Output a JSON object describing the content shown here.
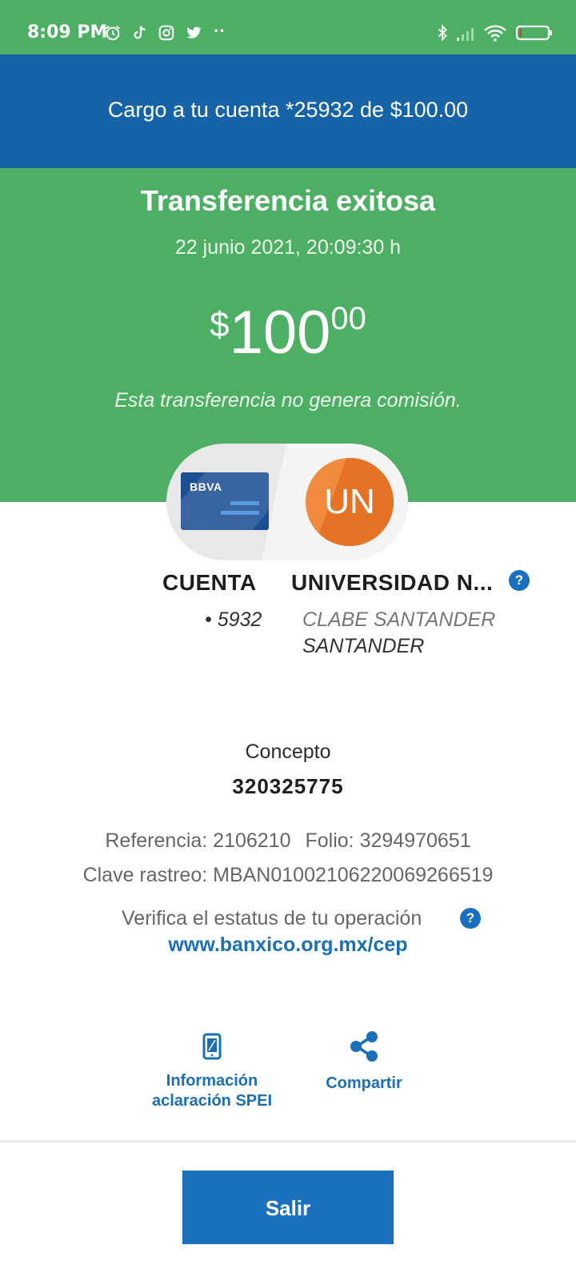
{
  "status_bar": {
    "time": "8:09 PM",
    "more": "··"
  },
  "banner": {
    "text": "Cargo a tu cuenta *25932 de $100.00"
  },
  "success": {
    "title": "Transferencia exitosa",
    "datetime": "22 junio 2021, 20:09:30 h",
    "amount_currency": "$",
    "amount_integer": "100",
    "amount_decimals": "00",
    "no_fee_text": "Esta transferencia no genera comisión."
  },
  "origin": {
    "bank_logo_text": "BBVA",
    "label": "CUENTA",
    "number": "• 5932"
  },
  "destination": {
    "avatar_initials": "UN",
    "name": "UNIVERSIDAD N...",
    "line1": "CLABE SANTANDER",
    "line2": "SANTANDER"
  },
  "concept": {
    "label": "Concepto",
    "value": "320325775"
  },
  "reference": {
    "text": "Referencia: 2106210",
    "folio": "Folio: 3294970651",
    "trace": "Clave rastreo: MBAN01002106220069266519"
  },
  "verify": {
    "text": "Verifica el estatus de tu operación",
    "link": "www.banxico.org.mx/cep"
  },
  "help_glyph": "?",
  "actions": {
    "spei_line1": "Información",
    "spei_line2": "aclaración SPEI",
    "share": "Compartir"
  },
  "exit_button": "Salir",
  "colors": {
    "green": "#4caf63",
    "blue_banner": "#1763a7",
    "accent_blue": "#1a71bd",
    "avatar_orange": "#f08a3c"
  }
}
